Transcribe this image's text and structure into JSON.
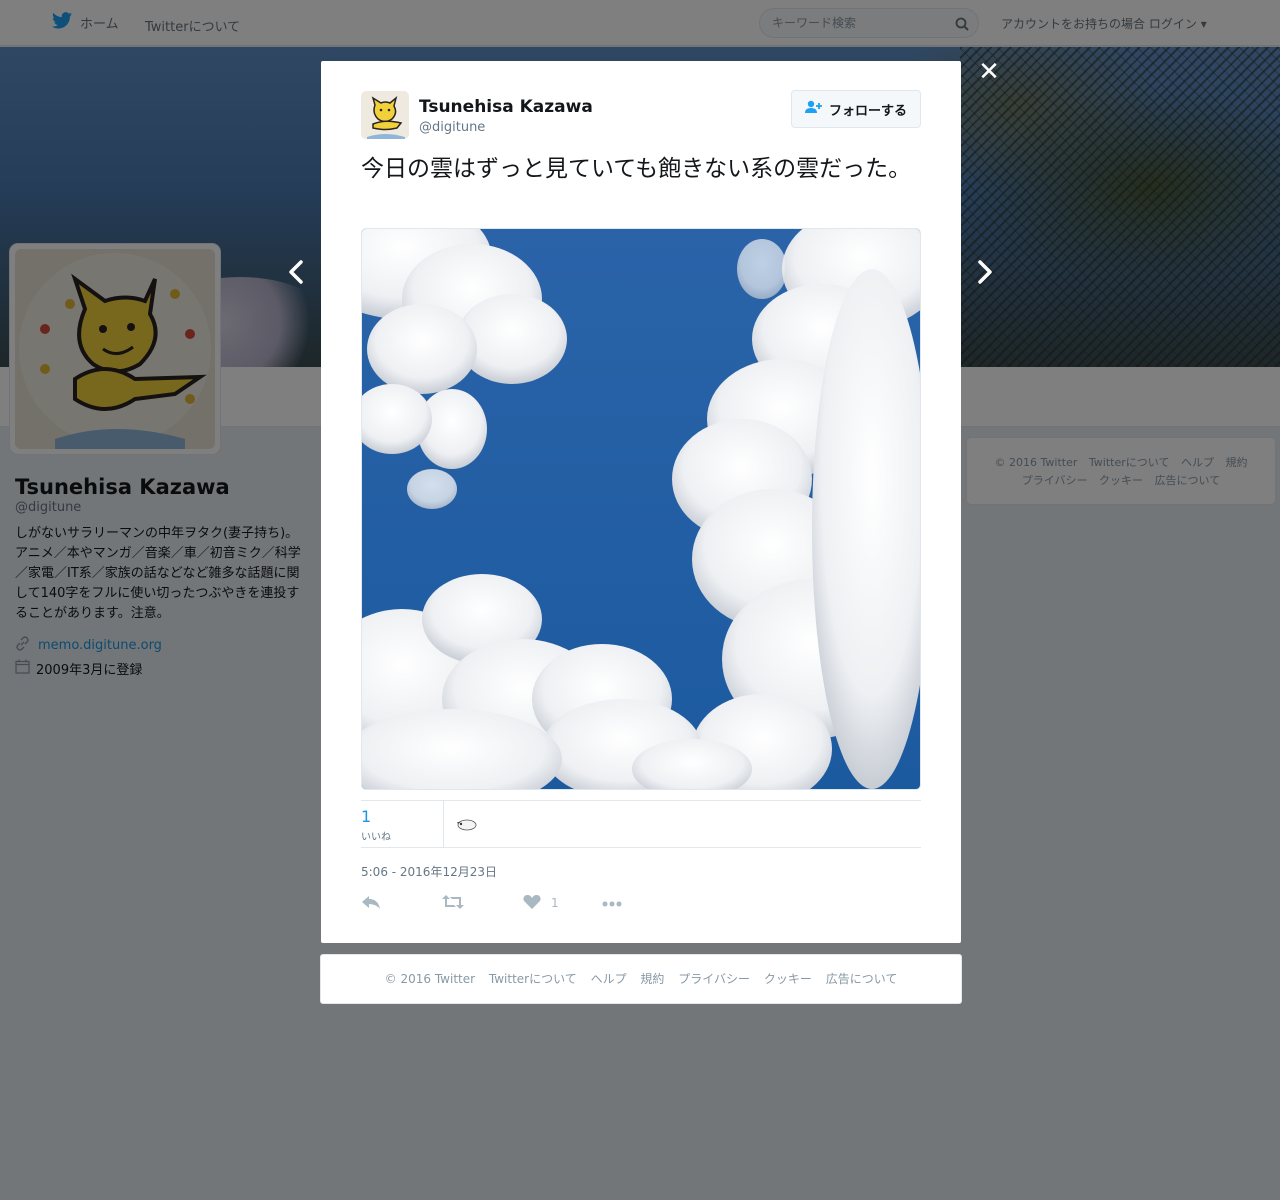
{
  "nav": {
    "home_label": "ホーム",
    "about_label": "Twitterについて",
    "search_placeholder": "キーワード検索",
    "login_prompt": "アカウントをお持ちの場合",
    "login_label": "ログイン"
  },
  "profile": {
    "name": "Tsunehisa Kazawa",
    "handle": "@digitune",
    "bio": "しがないサラリーマンの中年ヲタク(妻子持ち)。アニメ／本やマンガ／音楽／車／初音ミク／科学／家電／IT系／家族の話などなど雑多な話題に関して140字をフルに使い切ったつぶやきを連投することがあります。注意。",
    "url": "memo.digitune.org",
    "joined": "2009年3月に登録"
  },
  "side_footer": {
    "items": [
      "© 2016 Twitter",
      "Twitterについて",
      "ヘルプ",
      "規約",
      "プライバシー",
      "クッキー",
      "広告について"
    ]
  },
  "tweet": {
    "author_name": "Tsunehisa Kazawa",
    "author_handle": "@digitune",
    "follow_label": "フォローする",
    "text": "今日の雲はずっと見ていても飽きない系の雲だった。",
    "likes_count": "1",
    "likes_label": "いいね",
    "timestamp": "5:06 - 2016年12月23日",
    "action_like_count": "1"
  },
  "modal_footer": {
    "items": [
      "© 2016 Twitter",
      "Twitterについて",
      "ヘルプ",
      "規約",
      "プライバシー",
      "クッキー",
      "広告について"
    ]
  },
  "colors": {
    "accent": "#1b95e0",
    "twitter_blue": "#1da1f2",
    "overlay": "rgba(0,0,0,0.5)"
  }
}
